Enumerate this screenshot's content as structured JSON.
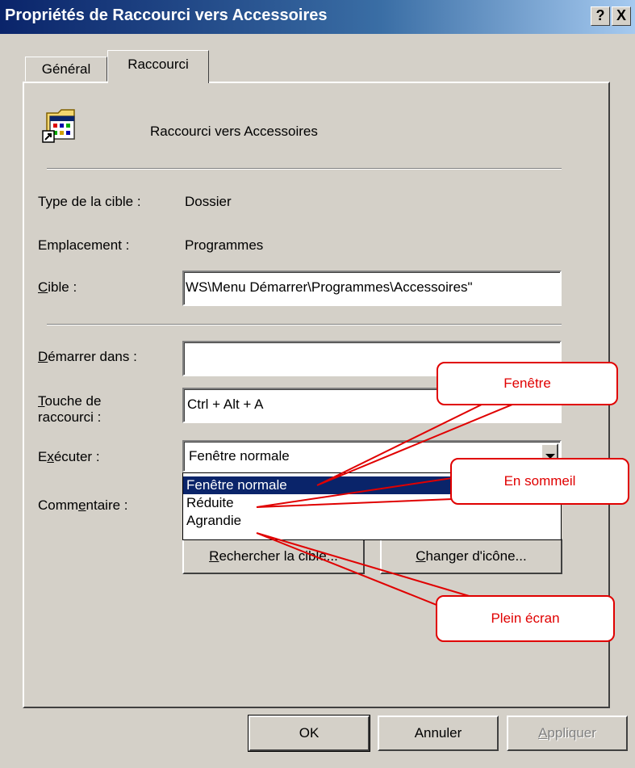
{
  "window": {
    "title": "Propriétés de Raccourci vers Accessoires",
    "help_label": "?",
    "close_label": "X"
  },
  "tabs": [
    {
      "label": "Général"
    },
    {
      "label": "Raccourci"
    }
  ],
  "header": {
    "name": "Raccourci vers Accessoires",
    "icon": "shortcut-folder-icon"
  },
  "fields": {
    "type_label": "Type de la cible :",
    "type_value": "Dossier",
    "location_label": "Emplacement :",
    "location_value": "Programmes",
    "target_label_u": "C",
    "target_label_rest": "ible :",
    "target_value": "WS\\Menu Démarrer\\Programmes\\Accessoires\"",
    "start_label_u": "D",
    "start_label_rest": "émarrer dans :",
    "start_value": "",
    "hotkey_label_u": "T",
    "hotkey_label_rest": "ouche de",
    "hotkey_label_line2": "raccourci :",
    "hotkey_value": "Ctrl + Alt + A",
    "run_label_pre": "E",
    "run_label_u": "x",
    "run_label_rest": "écuter :",
    "run_value": "Fenêtre normale",
    "comment_label_pre": "Comm",
    "comment_label_u": "e",
    "comment_label_rest": "ntaire :"
  },
  "dropdown": {
    "options": [
      "Fenêtre normale",
      "Réduite",
      "Agrandie"
    ],
    "selected_index": 0
  },
  "buttons": {
    "find_u": "R",
    "find_rest": "echercher la cible...",
    "change_pre": "",
    "change_u": "C",
    "change_rest": "hanger d'icône...",
    "ok": "OK",
    "cancel": "Annuler",
    "apply_u": "A",
    "apply_rest": "ppliquer"
  },
  "callouts": {
    "window": "Fenêtre",
    "sleep": "En sommeil",
    "full": "Plein écran"
  },
  "colors": {
    "callout": "#e00000",
    "selection": "#0a246a",
    "titlebar": "#0a246a"
  }
}
